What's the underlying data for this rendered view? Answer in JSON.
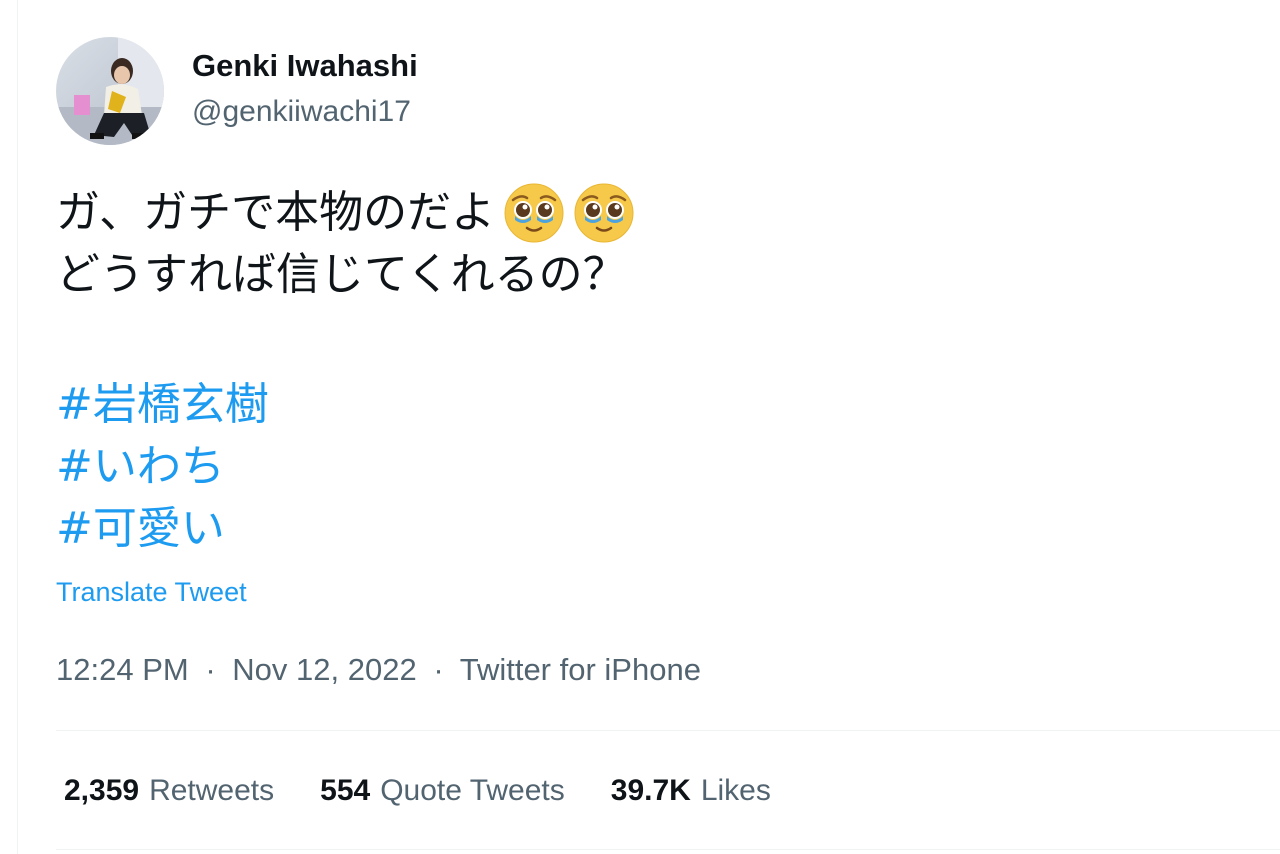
{
  "author": {
    "display_name": "Genki Iwahashi",
    "handle": "@genkiiwachi17"
  },
  "tweet": {
    "line1": "ガ、ガチで本物のだよ",
    "line1_emojis": [
      "pleading-face-with-tears",
      "pleading-face-with-tears"
    ],
    "line2": "どうすれば信じてくれるの？",
    "hashtags": [
      "#岩橋玄樹",
      "#いわち",
      "#可愛い"
    ],
    "translate_label": "Translate Tweet"
  },
  "meta": {
    "time": "12:24 PM",
    "separator": "·",
    "date": "Nov 12, 2022",
    "source": "Twitter for iPhone"
  },
  "stats": {
    "retweets": {
      "count": "2,359",
      "label": "Retweets"
    },
    "quotes": {
      "count": "554",
      "label": "Quote Tweets"
    },
    "likes": {
      "count": "39.7K",
      "label": "Likes"
    }
  },
  "colors": {
    "accent": "#1d9bf0",
    "text": "#0f1419",
    "secondary": "#536471",
    "border": "#eff3f4"
  }
}
